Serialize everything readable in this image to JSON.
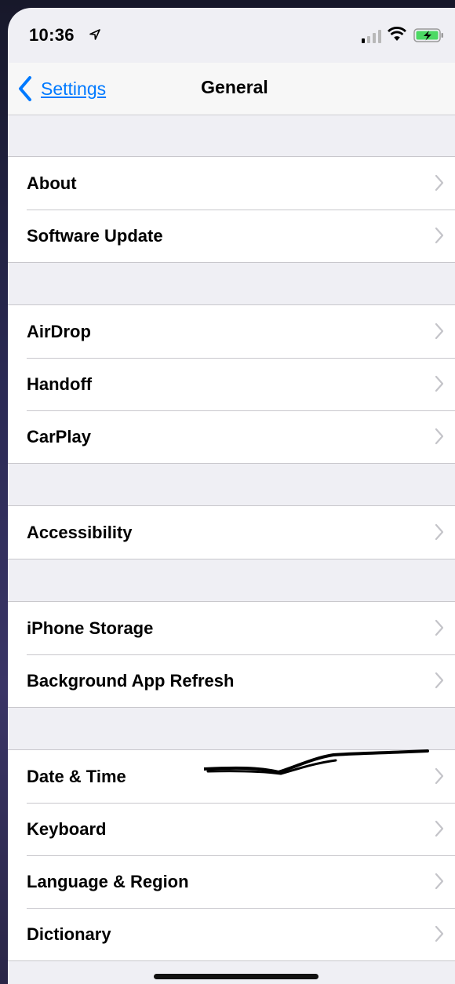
{
  "status_bar": {
    "time": "10:36",
    "icons": [
      "location-arrow-icon",
      "cellular-signal-icon",
      "wifi-icon",
      "battery-charging-icon"
    ]
  },
  "nav": {
    "back_label": "Settings",
    "title": "General"
  },
  "groups": [
    {
      "items": [
        {
          "label": "About"
        },
        {
          "label": "Software Update"
        }
      ]
    },
    {
      "items": [
        {
          "label": "AirDrop"
        },
        {
          "label": "Handoff"
        },
        {
          "label": "CarPlay"
        }
      ]
    },
    {
      "items": [
        {
          "label": "Accessibility"
        }
      ]
    },
    {
      "items": [
        {
          "label": "iPhone Storage"
        },
        {
          "label": "Background App Refresh"
        }
      ]
    },
    {
      "items": [
        {
          "label": "Date & Time"
        },
        {
          "label": "Keyboard"
        },
        {
          "label": "Language & Region"
        },
        {
          "label": "Dictionary"
        }
      ]
    }
  ],
  "colors": {
    "accent": "#007aff",
    "battery_green": "#4cd964",
    "group_background": "#efeff4",
    "separator": "#c8c7cc"
  }
}
